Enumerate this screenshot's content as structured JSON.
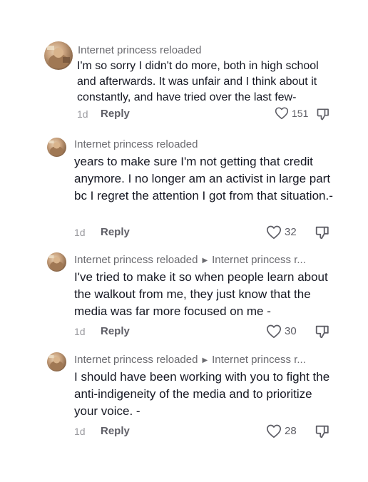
{
  "comments": [
    {
      "username": "Internet princess reloaded",
      "text": "I'm so sorry I didn't do more, both in high school and afterwards. It was unfair and I think about it constantly, and have tried over the last few-",
      "time": "1d",
      "reply_label": "Reply",
      "likes": "151"
    },
    {
      "username": "Internet princess reloaded",
      "text": "years to make sure I'm not getting that credit anymore. I no longer am an activist in large part bc I regret the attention I got from that situation.-",
      "time": "1d",
      "reply_label": "Reply",
      "likes": "32"
    },
    {
      "username": "Internet princess reloaded",
      "reply_to": "Internet princess r...",
      "text": "I've tried to make it so when people learn about the walkout from me, they just know that the media was far more focused on me -",
      "time": "1d",
      "reply_label": "Reply",
      "likes": "30"
    },
    {
      "username": "Internet princess reloaded",
      "reply_to": "Internet princess r...",
      "text": "I should have been working with you to fight the anti-indigeneity of the media and to prioritize your voice. -",
      "time": "1d",
      "reply_label": "Reply",
      "likes": "28"
    }
  ],
  "icons": {
    "like": "heart-outline-icon",
    "dislike": "thumbs-down-outline-icon"
  },
  "colors": {
    "username": "#6b6b70",
    "body_text": "#161823",
    "meta": "#9b9ba0"
  }
}
